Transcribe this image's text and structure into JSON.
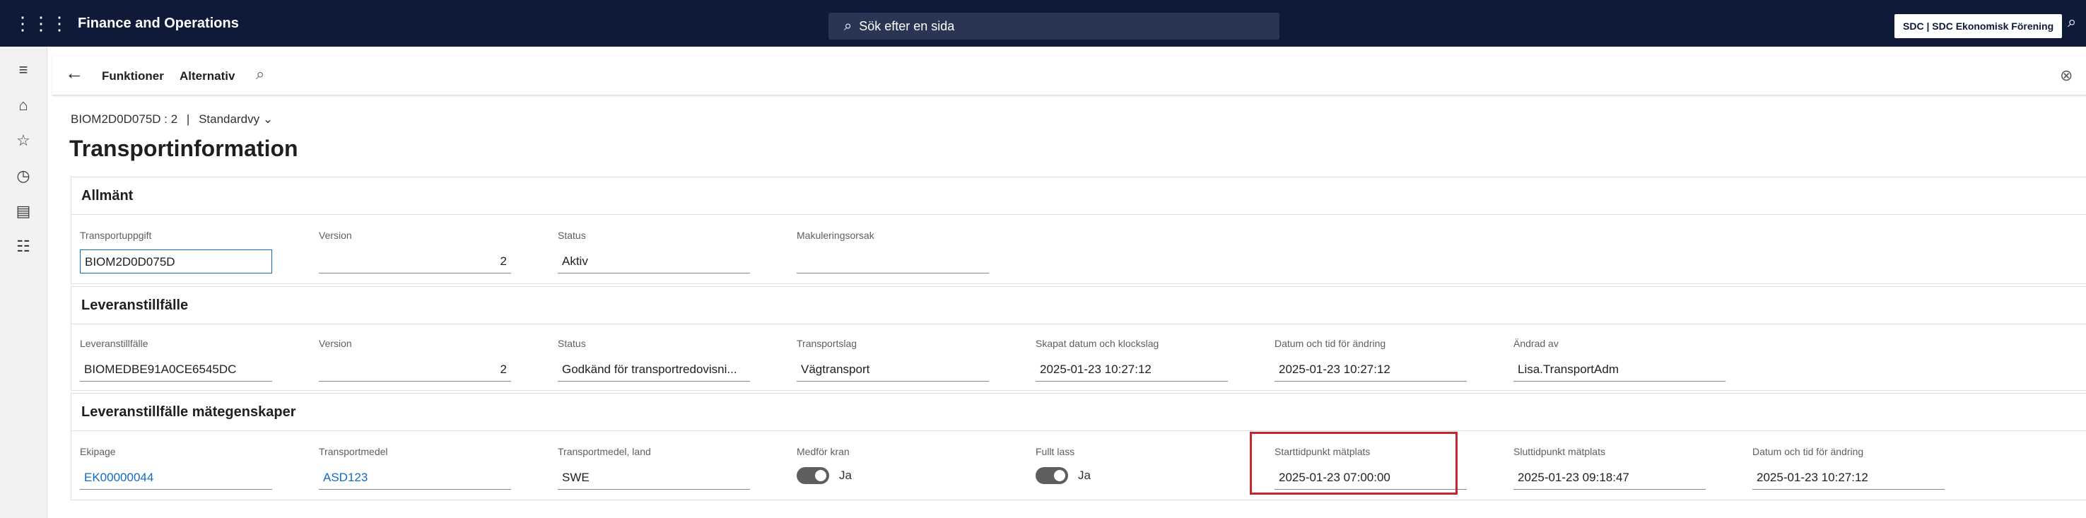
{
  "topbar": {
    "app_title": "Finance and Operations",
    "search_placeholder": "Sök efter en sida",
    "company": "SDC | SDC Ekonomisk Förening"
  },
  "actionbar": {
    "functions_label": "Funktioner",
    "options_label": "Alternativ"
  },
  "breadcrumb": {
    "record": "BIOM2D0D075D : 2",
    "separator": "|",
    "view": "Standardvy"
  },
  "page_title": "Transportinformation",
  "sections": {
    "general": {
      "title": "Allmänt",
      "fields": [
        {
          "label": "Transportuppgift",
          "value": "BIOM2D0D075D"
        },
        {
          "label": "Version",
          "value": "2"
        },
        {
          "label": "Status",
          "value": "Aktiv"
        },
        {
          "label": "Makuleringsorsak",
          "value": ""
        }
      ]
    },
    "delivery": {
      "title": "Leveranstillfälle",
      "fields": [
        {
          "label": "Leveranstillfälle",
          "value": "BIOMEDBE91A0CE6545DC"
        },
        {
          "label": "Version",
          "value": "2"
        },
        {
          "label": "Status",
          "value": "Godkänd för transportredovisni..."
        },
        {
          "label": "Transportslag",
          "value": "Vägtransport"
        },
        {
          "label": "Skapat datum och klockslag",
          "value": "2025-01-23 10:27:12"
        },
        {
          "label": "Datum och tid för ändring",
          "value": "2025-01-23 10:27:12"
        },
        {
          "label": "Ändrad av",
          "value": "Lisa.TransportAdm"
        }
      ]
    },
    "measurements": {
      "title": "Leveranstillfälle mätegenskaper",
      "fields": [
        {
          "label": "Ekipage",
          "value": "EK00000044"
        },
        {
          "label": "Transportmedel",
          "value": "ASD123"
        },
        {
          "label": "Transportmedel, land",
          "value": "SWE"
        },
        {
          "label": "Medför kran",
          "value": "Ja"
        },
        {
          "label": "Fullt lass",
          "value": "Ja"
        },
        {
          "label": "Starttidpunkt mätplats",
          "value": "2025-01-23 07:00:00"
        },
        {
          "label": "Sluttidpunkt mätplats",
          "value": "2025-01-23 09:18:47"
        },
        {
          "label": "Datum och tid för ändring",
          "value": "2025-01-23 10:27:12"
        }
      ]
    }
  },
  "icons": {
    "waffle": "app-launcher-icon",
    "search": "search-icon",
    "back": "back-arrow-icon",
    "find": "search-icon",
    "help": "help-icon"
  },
  "colors": {
    "topbar": "#0e1a37",
    "link": "#0f6cbd",
    "highlight": "#c4262e"
  }
}
